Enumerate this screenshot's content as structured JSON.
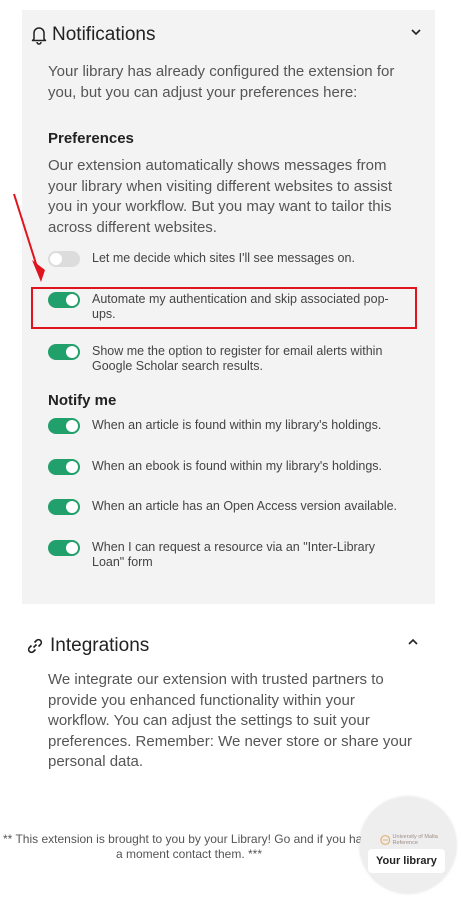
{
  "notifications": {
    "title": "Notifications",
    "intro": "Your library has already configured the extension for you, but you can adjust your preferences here:",
    "preferences_heading": "Preferences",
    "preferences_desc": "Our extension automatically shows messages from your library when visiting different websites to assist you in your workflow. But you may want to tailor this across different websites.",
    "options": [
      {
        "label": "Let me decide which sites I'll see messages on.",
        "state": "off"
      },
      {
        "label": "Automate my authentication and skip associated pop-ups.",
        "state": "on"
      },
      {
        "label": "Show me the option to register for email alerts within Google Scholar search results.",
        "state": "on"
      }
    ],
    "notify_heading": "Notify me",
    "notify_options": [
      {
        "label": "When an article is found within my library's holdings.",
        "state": "on"
      },
      {
        "label": "When an ebook is found within my library's holdings.",
        "state": "on"
      },
      {
        "label": "When an article has an Open Access version available.",
        "state": "on"
      },
      {
        "label": "When I can request a resource via an \"Inter-Library Loan\" form",
        "state": "on"
      }
    ]
  },
  "integrations": {
    "title": "Integrations",
    "desc": "We integrate our extension with trusted partners to provide you enhanced functionality within your workflow. You can adjust the settings to suit your preferences. Remember: We never store or share your personal data."
  },
  "footer": {
    "text": "** This extension is brought to you by your Library! Go and if you have a moment contact them. ***"
  },
  "library_button": {
    "label": "Your library",
    "logo_text": "University of Malta Reference"
  },
  "colors": {
    "toggle_on": "#22a06b",
    "toggle_off": "#dcdcdc",
    "highlight": "#e0141e",
    "panel_bg": "#f3f3f3"
  },
  "icons": [
    "bell-icon",
    "chevron-down-icon",
    "link-icon",
    "chevron-up-icon",
    "arrow-icon",
    "university-logo-icon"
  ]
}
